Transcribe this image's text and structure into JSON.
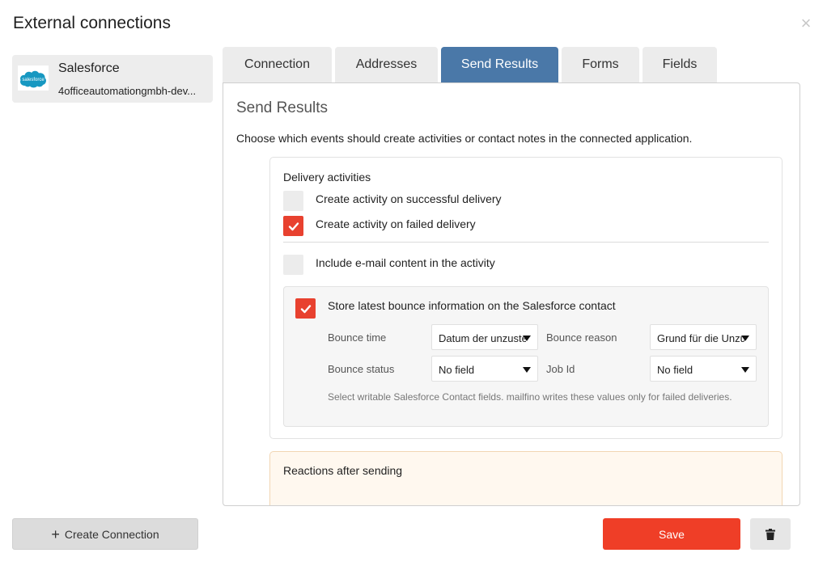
{
  "dialog": {
    "title": "External connections"
  },
  "sidebar": {
    "connections": [
      {
        "name": "Salesforce",
        "subtitle": "4officeautomationgmbh-dev...",
        "logo_icon": "salesforce-cloud-icon",
        "logo_color": "#1798c1"
      }
    ]
  },
  "tabs": [
    {
      "label": "Connection",
      "active": false
    },
    {
      "label": "Addresses",
      "active": false
    },
    {
      "label": "Send Results",
      "active": true
    },
    {
      "label": "Forms",
      "active": false
    },
    {
      "label": "Fields",
      "active": false
    }
  ],
  "panel": {
    "title": "Send Results",
    "description": "Choose which events should create activities or contact notes in the connected application.",
    "delivery": {
      "heading": "Delivery activities",
      "options": [
        {
          "label": "Create activity on successful delivery",
          "checked": false
        },
        {
          "label": "Create activity on failed delivery",
          "checked": true
        },
        {
          "label": "Include e-mail content in the activity",
          "checked": false
        }
      ],
      "bounce": {
        "label": "Store latest bounce information on the Salesforce contact",
        "checked": true,
        "fields": [
          {
            "label": "Bounce time",
            "value": "Datum der unzustellbarkeit"
          },
          {
            "label": "Bounce reason",
            "value": "Grund für die Unzustellbarkeit"
          },
          {
            "label": "Bounce status",
            "value": "No field"
          },
          {
            "label": "Job Id",
            "value": "No field"
          }
        ],
        "hint": "Select writable Salesforce Contact fields. mailfino writes these values only for failed deliveries."
      }
    },
    "reactions": {
      "title": "Reactions after sending"
    }
  },
  "footer": {
    "create_label": "Create Connection",
    "save_label": "Save"
  },
  "colors": {
    "accent_tab": "#4a78a8",
    "primary_button": "#ef3e27",
    "checkbox_checked": "#e8412f"
  }
}
